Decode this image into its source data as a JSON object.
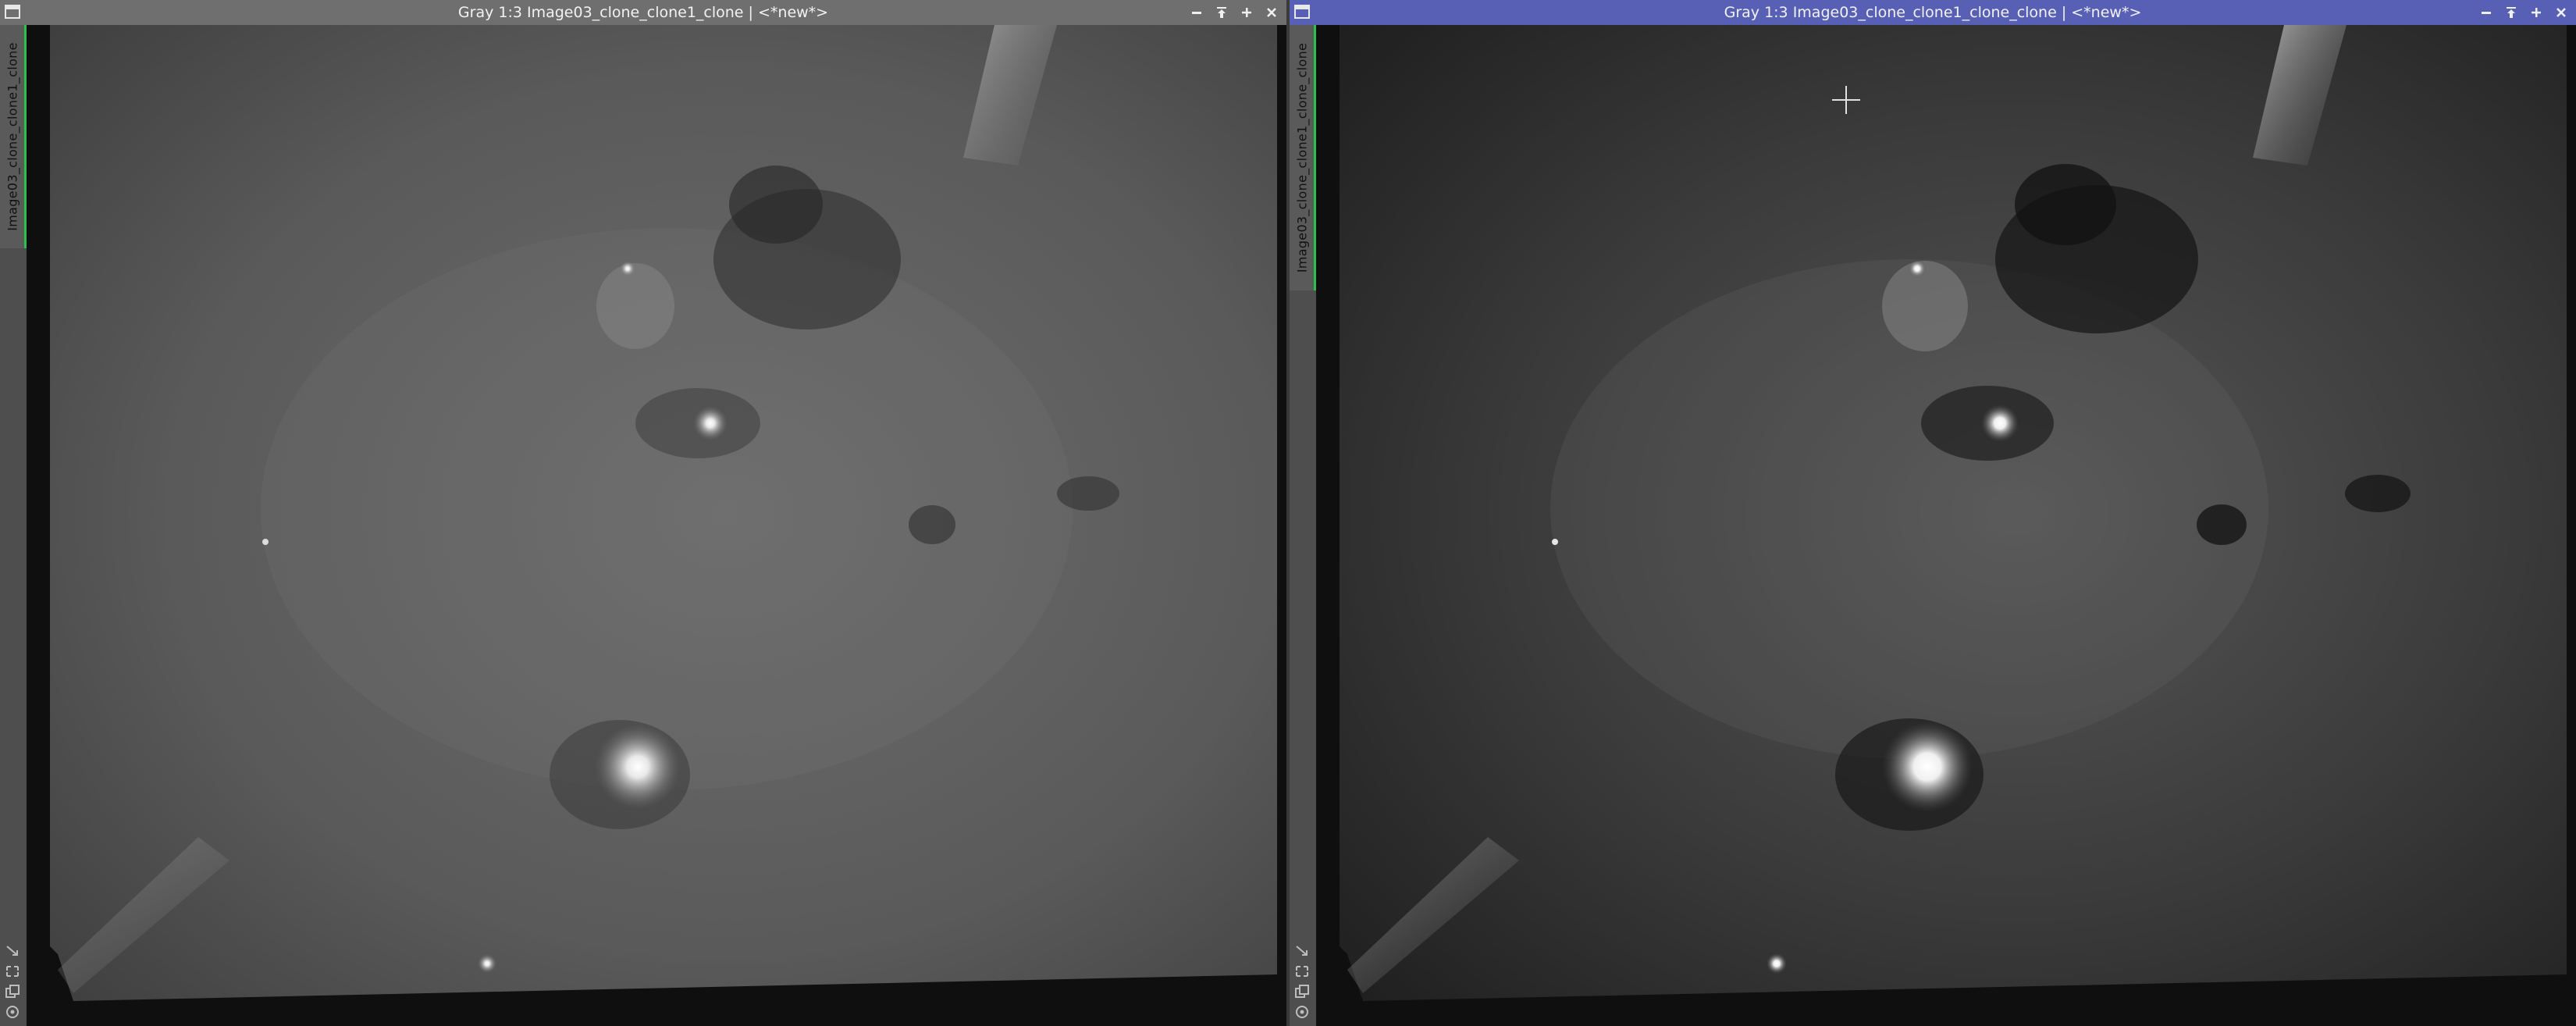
{
  "windows": [
    {
      "title": "Gray 1:3 Image03_clone_clone1_clone | <*new*>",
      "tab_label": "Image03_clone_clone1_clone",
      "state": "inactive",
      "stretch": "mild"
    },
    {
      "title": "Gray 1:3 Image03_clone_clone1_clone_clone | <*new*>",
      "tab_label": "Image03_clone_clone1_clone_clone",
      "state": "active",
      "stretch": "strong"
    }
  ],
  "controls": [
    "minimize-icon",
    "shade-icon",
    "maximize-icon",
    "close-icon"
  ],
  "side_tools": [
    "fit-icon",
    "zoom-icon",
    "clone-icon",
    "settings-icon"
  ],
  "colors": {
    "active_title": "#5860b6",
    "inactive_title": "#6f6f6f",
    "tab_accent": "#2fbf4e"
  }
}
